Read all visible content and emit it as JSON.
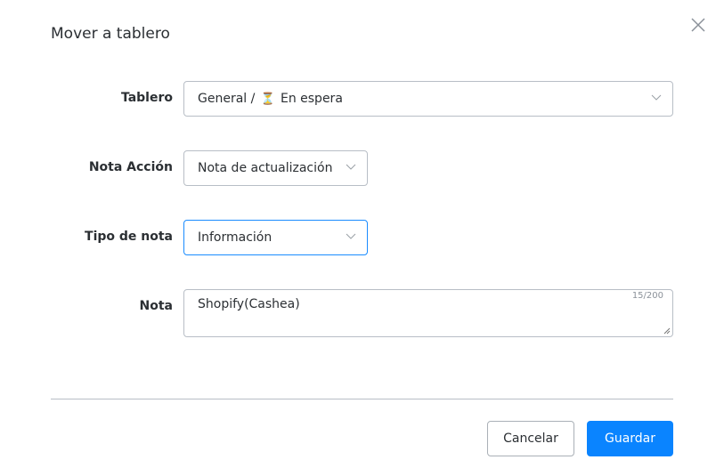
{
  "dialog": {
    "title": "Mover a tablero"
  },
  "fields": {
    "tablero": {
      "label": "Tablero",
      "value_prefix": "General / ",
      "icon": "⏳",
      "value": "En espera"
    },
    "nota_accion": {
      "label": "Nota Acción",
      "value": "Nota de actualización"
    },
    "tipo_nota": {
      "label": "Tipo de nota",
      "value": "Información"
    },
    "nota": {
      "label": "Nota",
      "value": "Shopify(Cashea)",
      "count": "15/200"
    }
  },
  "buttons": {
    "cancel": "Cancelar",
    "save": "Guardar"
  },
  "colors": {
    "primary": "#0a84ff"
  }
}
